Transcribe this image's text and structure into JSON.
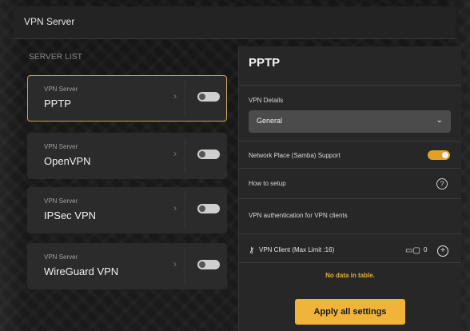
{
  "header": {
    "title": "VPN Server"
  },
  "server_list": {
    "label": "SERVER LIST",
    "items": [
      {
        "small": "VPN Server",
        "name": "PPTP",
        "enabled": false
      },
      {
        "small": "VPN Server",
        "name": "OpenVPN",
        "enabled": false
      },
      {
        "small": "VPN Server",
        "name": "IPSec VPN",
        "enabled": false
      },
      {
        "small": "VPN Server",
        "name": "WireGuard VPN",
        "enabled": false
      }
    ]
  },
  "details": {
    "title": "PPTP",
    "vpn_details_label": "VPN Details",
    "select_value": "General",
    "samba_label": "Network Place (Samba) Support",
    "samba_enabled": true,
    "how_to_setup": "How to setup",
    "auth_label": "VPN authentication for VPN clients",
    "vpn_client_label": "VPN Client (Max Limit :16)",
    "vpn_client_count": "0",
    "no_data": "No data in table.",
    "apply_label": "Apply all settings"
  },
  "icons": {
    "chevron": "chevron-right-icon",
    "help": "help-icon",
    "key": "key-icon",
    "devices": "devices-icon",
    "add": "add-icon",
    "caret": "chevron-down-icon"
  },
  "colors": {
    "accent": "#e0a126",
    "selected_border": "#c8a25a",
    "button": "#f0b43a",
    "bg": "#161616"
  }
}
